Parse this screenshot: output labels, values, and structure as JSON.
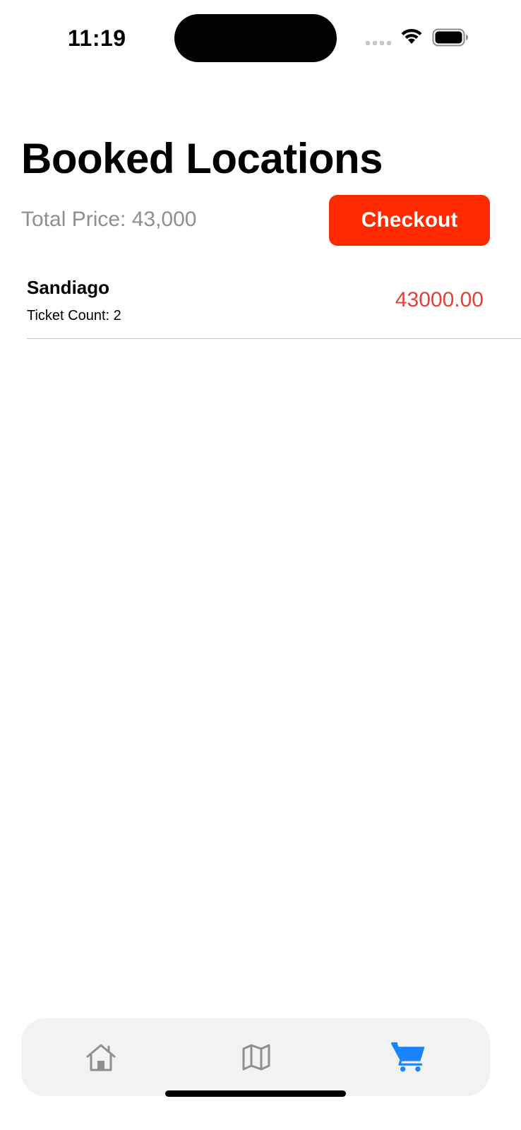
{
  "status_bar": {
    "time": "11:19"
  },
  "header": {
    "title": "Booked Locations",
    "total_price": "Total Price: 43,000",
    "checkout_label": "Checkout"
  },
  "bookings": [
    {
      "location": "Sandiago",
      "ticket_count": "Ticket Count: 2",
      "price": "43000.00"
    }
  ],
  "tab_bar": {
    "tabs": [
      {
        "icon": "home-icon",
        "selected": false
      },
      {
        "icon": "map-icon",
        "selected": false
      },
      {
        "icon": "cart-icon",
        "selected": true
      }
    ]
  },
  "colors": {
    "accent": "#ff2a00",
    "price": "#e0413a",
    "tab_selected": "#1a84ff",
    "tab_unselected": "#8e8e93"
  }
}
